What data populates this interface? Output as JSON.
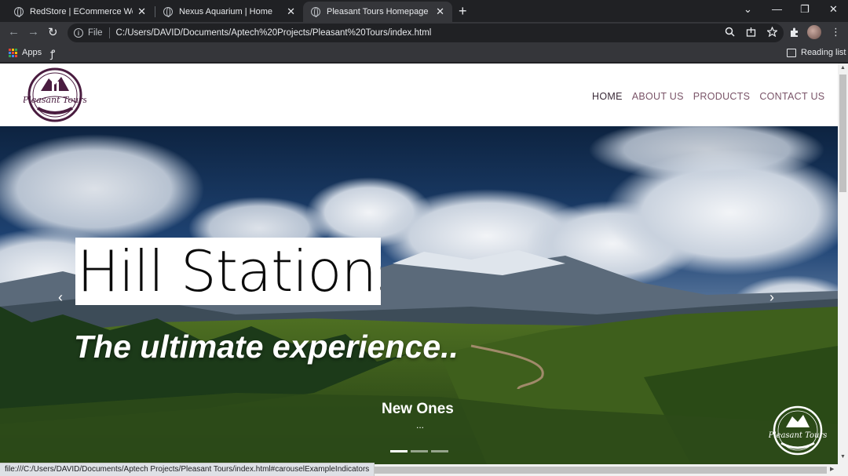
{
  "browser": {
    "tabs": [
      {
        "title": "RedStore | ECommerce Website f",
        "active": false
      },
      {
        "title": "Nexus Aquarium | Home",
        "active": false
      },
      {
        "title": "Pleasant Tours Homepage",
        "active": true
      }
    ],
    "new_tab_glyph": "+",
    "close_glyph": "✕",
    "window_controls": {
      "dropdown": "⌄",
      "minimize": "—",
      "restore": "❐",
      "close": "✕"
    },
    "nav": {
      "back": "←",
      "forward": "→",
      "reload": "↻"
    },
    "address": {
      "scheme_label": "File",
      "url": "C:/Users/DAVID/Documents/Aptech%20Projects/Pleasant%20Tours/index.html"
    },
    "bookmarks": {
      "apps_label": "Apps",
      "reading_list_label": "Reading list"
    },
    "status_url": "file:///C:/Users/DAVID/Documents/Aptech Projects/Pleasant Tours/index.html#carouselExampleIndicators"
  },
  "site": {
    "logo_text": "Pleasant Tours",
    "nav": [
      {
        "label": "HOME",
        "active": true
      },
      {
        "label": "ABOUT US",
        "active": false
      },
      {
        "label": "PRODUCTS",
        "active": false
      },
      {
        "label": "CONTACT US",
        "active": false
      }
    ],
    "hero": {
      "title": "Hill Stations",
      "subtitle": "The ultimate experience..",
      "caption_title": "New Ones",
      "caption_text": "...",
      "prev_glyph": "‹",
      "next_glyph": "›",
      "active_slide": 0,
      "slide_count": 3
    }
  },
  "colors": {
    "brand": "#5a2a4e",
    "nav_link": "#7a5468",
    "chrome_dark": "#202124",
    "chrome_toolbar": "#35363a"
  }
}
